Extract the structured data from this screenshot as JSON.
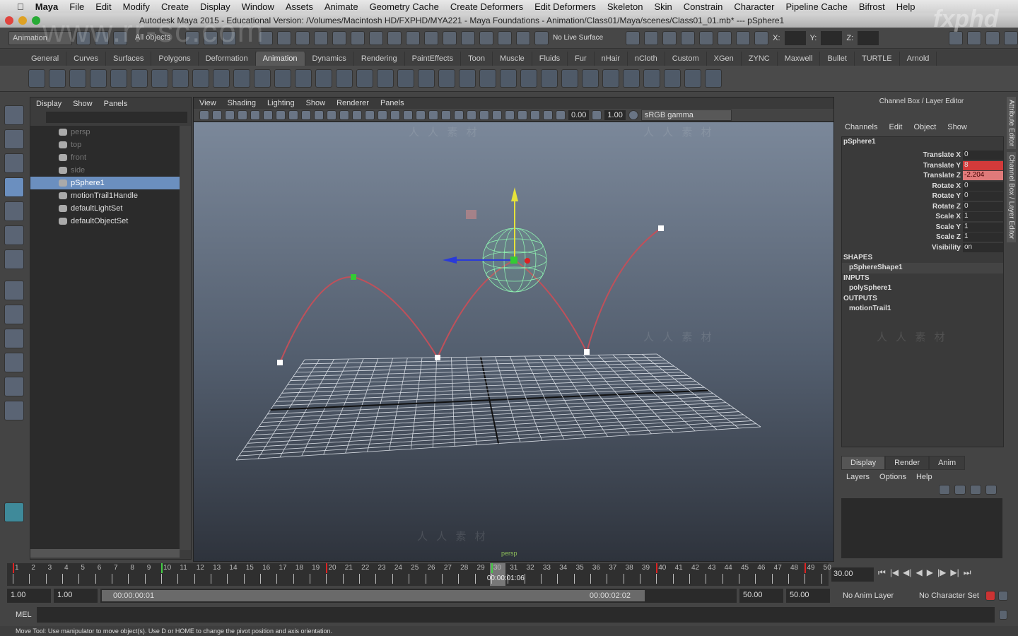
{
  "menubar": {
    "app": "Maya",
    "items": [
      "File",
      "Edit",
      "Modify",
      "Create",
      "Display",
      "Window",
      "Assets",
      "Animate",
      "Geometry Cache",
      "Create Deformers",
      "Edit Deformers",
      "Skeleton",
      "Skin",
      "Constrain",
      "Character",
      "Pipeline Cache",
      "Bifrost",
      "Help"
    ]
  },
  "window": {
    "title": "Autodesk Maya 2015 - Educational Version: /Volumes/Macintosh HD/FXPHD/MYA221 - Maya Foundations - Animation/Class01/Maya/scenes/Class01_01.mb*  ---  pSphere1"
  },
  "statusline": {
    "menu_set": "Animation",
    "selection_mask": "All objects",
    "live_surface": "No Live Surface",
    "x_label": "X:",
    "y_label": "Y:",
    "z_label": "Z:"
  },
  "shelf": {
    "tabs": [
      "General",
      "Curves",
      "Surfaces",
      "Polygons",
      "Deformation",
      "Animation",
      "Dynamics",
      "Rendering",
      "PaintEffects",
      "Toon",
      "Muscle",
      "Fluids",
      "Fur",
      "nHair",
      "nCloth",
      "Custom",
      "XGen",
      "ZYNC",
      "Maxwell",
      "Bullet",
      "TURTLE",
      "Arnold"
    ],
    "active": "Animation"
  },
  "outliner": {
    "menu": [
      "Display",
      "Show",
      "Panels"
    ],
    "items": [
      {
        "label": "persp",
        "dim": true
      },
      {
        "label": "top",
        "dim": true
      },
      {
        "label": "front",
        "dim": true
      },
      {
        "label": "side",
        "dim": true
      },
      {
        "label": "pSphere1",
        "selected": true
      },
      {
        "label": "motionTrail1Handle"
      },
      {
        "label": "defaultLightSet"
      },
      {
        "label": "defaultObjectSet"
      }
    ]
  },
  "viewport": {
    "menu": [
      "View",
      "Shading",
      "Lighting",
      "Show",
      "Renderer",
      "Panels"
    ],
    "exposure": "0.00",
    "gamma": "1.00",
    "color_space": "sRGB gamma",
    "camera": "persp"
  },
  "channelbox": {
    "title": "Channel Box / Layer Editor",
    "menu": [
      "Channels",
      "Edit",
      "Object",
      "Show"
    ],
    "object": "pSphere1",
    "channels": [
      {
        "label": "Translate X",
        "value": "0"
      },
      {
        "label": "Translate Y",
        "value": "8",
        "state": "keyed"
      },
      {
        "label": "Translate Z",
        "value": "-2.204",
        "state": "changed"
      },
      {
        "label": "Rotate X",
        "value": "0"
      },
      {
        "label": "Rotate Y",
        "value": "0"
      },
      {
        "label": "Rotate Z",
        "value": "0"
      },
      {
        "label": "Scale X",
        "value": "1"
      },
      {
        "label": "Scale Y",
        "value": "1"
      },
      {
        "label": "Scale Z",
        "value": "1"
      },
      {
        "label": "Visibility",
        "value": "on"
      }
    ],
    "shapes_label": "SHAPES",
    "shapes": "pSphereShape1",
    "inputs_label": "INPUTS",
    "inputs": "polySphere1",
    "outputs_label": "OUTPUTS",
    "outputs": "motionTrail1"
  },
  "layereditor": {
    "tabs": [
      "Display",
      "Render",
      "Anim"
    ],
    "menu": [
      "Layers",
      "Options",
      "Help"
    ]
  },
  "side_tabs": [
    "Attribute Editor",
    "Channel Box / Layer Editor"
  ],
  "timeline": {
    "start": 1,
    "end": 50,
    "current_frame": 30,
    "current_time": "00:00:01:06",
    "frame_field": "30.00",
    "key_frames": [
      1,
      10,
      20,
      30,
      40,
      49
    ],
    "playback_buttons": [
      "go-start",
      "step-back-key",
      "step-back",
      "play-back",
      "play-forward",
      "step-forward",
      "step-forward-key",
      "go-end"
    ]
  },
  "range": {
    "start": "1.00",
    "playback_start": "1.00",
    "range_start_time": "00:00:00:01",
    "range_end_time": "00:00:02:02",
    "playback_end": "50.00",
    "end": "50.00",
    "anim_layer": "No Anim Layer",
    "character_set": "No Character Set"
  },
  "mel": {
    "label": "MEL"
  },
  "helpline": "Move Tool: Use manipulator to move object(s). Use D or HOME to change the pivot position and axis orientation.",
  "watermark": {
    "text": "人 人 素 材",
    "url": "www.rr-sc.com",
    "brand": "fxphd"
  },
  "colors": {
    "selection": "#6b8fbf",
    "keyed": "#d33a3a",
    "changed": "#e07a7a",
    "trail": "#c0505a"
  }
}
